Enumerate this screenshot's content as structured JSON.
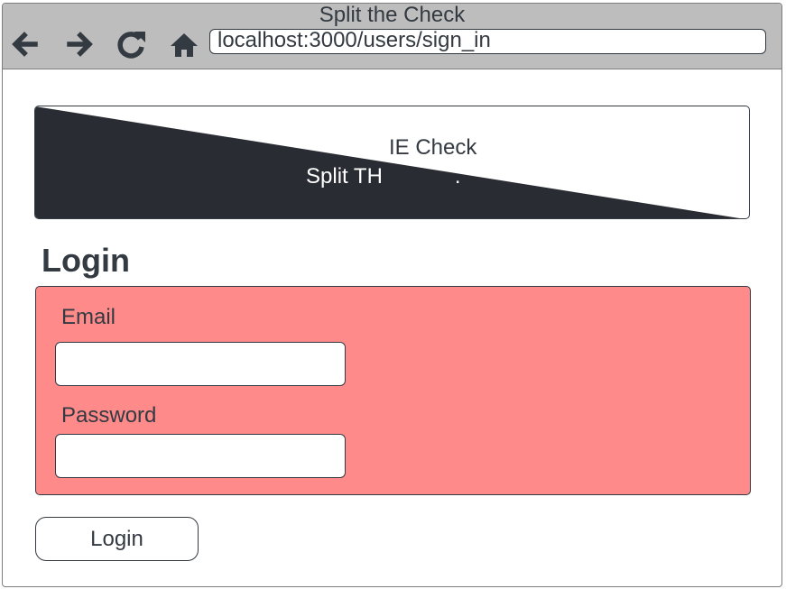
{
  "browser": {
    "title": "Split the Check",
    "url": "localhost:3000/users/sign_in",
    "nav_icons": [
      "back-arrow-icon",
      "forward-arrow-icon",
      "reload-icon",
      "home-icon"
    ]
  },
  "banner": {
    "text_dark": "IE Check",
    "text_light": "Split TH            ."
  },
  "page": {
    "heading": "Login"
  },
  "form": {
    "panel_color": "#ff8a8a",
    "email_label": "Email",
    "email_value": "",
    "password_label": "Password",
    "password_value": ""
  },
  "actions": {
    "login_label": "Login"
  },
  "colors": {
    "chrome": "#bdbdbd",
    "text": "#333a41",
    "banner_dark": "#292d33"
  }
}
